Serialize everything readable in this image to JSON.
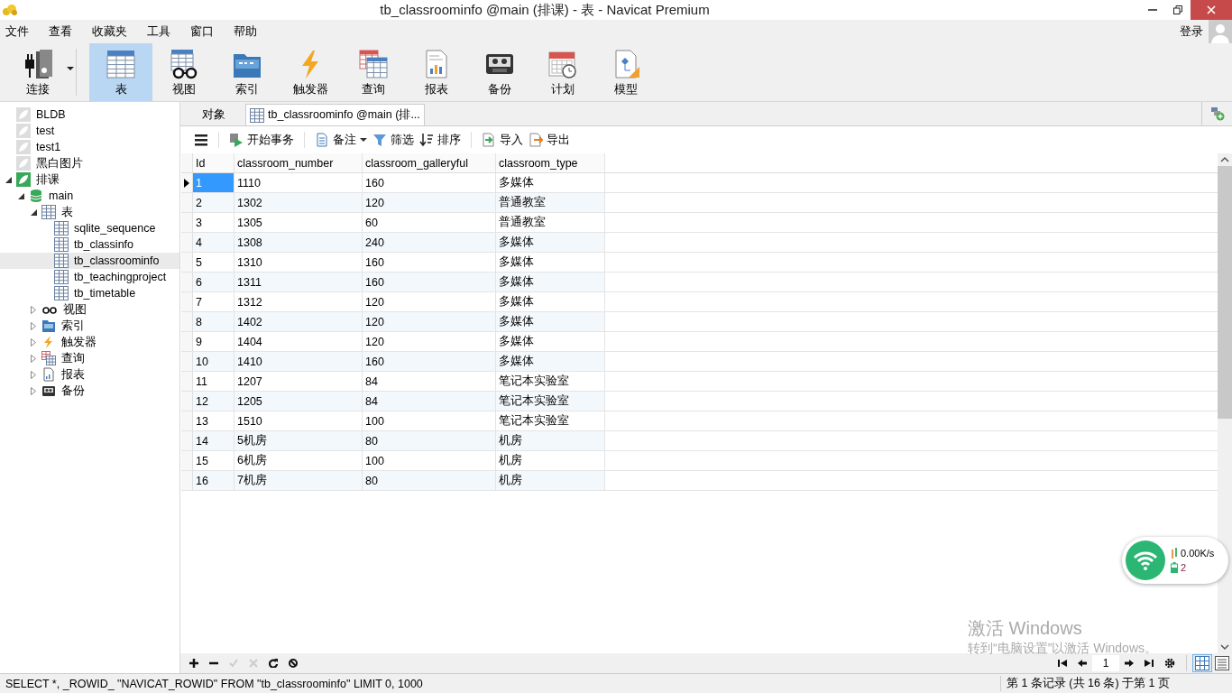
{
  "window": {
    "title": "tb_classroominfo @main (排课) - 表 - Navicat Premium"
  },
  "menu": [
    "文件",
    "查看",
    "收藏夹",
    "工具",
    "窗口",
    "帮助"
  ],
  "login": "登录",
  "toolbar": [
    {
      "kind": "connect",
      "label": "连接",
      "selected": false
    },
    {
      "kind": "table",
      "label": "表",
      "selected": true
    },
    {
      "kind": "view",
      "label": "视图",
      "selected": false
    },
    {
      "kind": "index",
      "label": "索引",
      "selected": false
    },
    {
      "kind": "trigger",
      "label": "触发器",
      "selected": false
    },
    {
      "kind": "query",
      "label": "查询",
      "selected": false
    },
    {
      "kind": "report",
      "label": "报表",
      "selected": false
    },
    {
      "kind": "backup",
      "label": "备份",
      "selected": false
    },
    {
      "kind": "schedule",
      "label": "计划",
      "selected": false
    },
    {
      "kind": "model",
      "label": "模型",
      "selected": false
    }
  ],
  "tree": [
    {
      "kind": "conn-off",
      "label": "BLDB",
      "selected": false
    },
    {
      "kind": "conn-off",
      "label": "test",
      "selected": false
    },
    {
      "kind": "conn-off",
      "label": "test1",
      "selected": false
    },
    {
      "kind": "conn-off",
      "label": "黑白图片",
      "selected": false
    },
    {
      "kind": "conn-on",
      "label": "排课",
      "selected": false,
      "expanded": true,
      "children": [
        {
          "kind": "db",
          "label": "main",
          "selected": false,
          "expanded": true,
          "children": [
            {
              "kind": "table",
              "label": "表",
              "selected": false,
              "expanded": true,
              "children": [
                {
                  "kind": "table",
                  "label": "sqlite_sequence",
                  "selected": false
                },
                {
                  "kind": "table",
                  "label": "tb_classinfo",
                  "selected": false
                },
                {
                  "kind": "table",
                  "label": "tb_classroominfo",
                  "selected": true
                },
                {
                  "kind": "table",
                  "label": "tb_teachingproject",
                  "selected": false
                },
                {
                  "kind": "table",
                  "label": "tb_timetable",
                  "selected": false
                }
              ]
            },
            {
              "kind": "view",
              "label": "视图",
              "selected": false,
              "expanded": false
            },
            {
              "kind": "index",
              "label": "索引",
              "selected": false,
              "expanded": false
            },
            {
              "kind": "trigger",
              "label": "触发器",
              "selected": false,
              "expanded": false
            },
            {
              "kind": "query",
              "label": "查询",
              "selected": false,
              "expanded": false
            },
            {
              "kind": "report",
              "label": "报表",
              "selected": false,
              "expanded": false
            },
            {
              "kind": "backup",
              "label": "备份",
              "selected": false,
              "expanded": false
            }
          ]
        }
      ]
    }
  ],
  "tabs": [
    {
      "label": "对象",
      "selected": false,
      "kind": "plain"
    },
    {
      "label": "tb_classroominfo @main (排...",
      "selected": true,
      "kind": "table"
    }
  ],
  "grid_toolbar": [
    {
      "kind": "menu"
    },
    {
      "kind": "begin",
      "label": "开始事务"
    },
    {
      "kind": "note",
      "label": "备注"
    },
    {
      "kind": "filter",
      "label": "筛选"
    },
    {
      "kind": "sort",
      "label": "排序"
    },
    {
      "kind": "import",
      "label": "导入"
    },
    {
      "kind": "export",
      "label": "导出"
    }
  ],
  "table": {
    "columns": [
      "Id",
      "classroom_number",
      "classroom_galleryful",
      "classroom_type"
    ],
    "rows": [
      {
        "selected": true,
        "cells": [
          "1",
          "1110",
          "160",
          "多媒体"
        ]
      },
      {
        "selected": false,
        "cells": [
          "2",
          "1302",
          "120",
          "普通教室"
        ]
      },
      {
        "selected": false,
        "cells": [
          "3",
          "1305",
          "60",
          "普通教室"
        ]
      },
      {
        "selected": false,
        "cells": [
          "4",
          "1308",
          "240",
          "多媒体"
        ]
      },
      {
        "selected": false,
        "cells": [
          "5",
          "1310",
          "160",
          "多媒体"
        ]
      },
      {
        "selected": false,
        "cells": [
          "6",
          "1311",
          "160",
          "多媒体"
        ]
      },
      {
        "selected": false,
        "cells": [
          "7",
          "1312",
          "120",
          "多媒体"
        ]
      },
      {
        "selected": false,
        "cells": [
          "8",
          "1402",
          "120",
          "多媒体"
        ]
      },
      {
        "selected": false,
        "cells": [
          "9",
          "1404",
          "120",
          "多媒体"
        ]
      },
      {
        "selected": false,
        "cells": [
          "10",
          "1410",
          "160",
          "多媒体"
        ]
      },
      {
        "selected": false,
        "cells": [
          "11",
          "1207",
          "84",
          "笔记本实验室"
        ]
      },
      {
        "selected": false,
        "cells": [
          "12",
          "1205",
          "84",
          "笔记本实验室"
        ]
      },
      {
        "selected": false,
        "cells": [
          "13",
          "1510",
          "100",
          "笔记本实验室"
        ]
      },
      {
        "selected": false,
        "cells": [
          "14",
          "5机房",
          "80",
          "机房"
        ]
      },
      {
        "selected": false,
        "cells": [
          "15",
          "6机房",
          "100",
          "机房"
        ]
      },
      {
        "selected": false,
        "cells": [
          "16",
          "7机房",
          "80",
          "机房"
        ]
      }
    ]
  },
  "edit_tools": [
    {
      "kind": "add",
      "disabled": false
    },
    {
      "kind": "delete",
      "disabled": false
    },
    {
      "kind": "apply",
      "disabled": true
    },
    {
      "kind": "discard",
      "disabled": true
    },
    {
      "kind": "refresh",
      "disabled": false
    },
    {
      "kind": "stop",
      "disabled": false
    }
  ],
  "pager": {
    "page": "1"
  },
  "view_modes": [
    {
      "kind": "grid",
      "selected": true
    },
    {
      "kind": "form",
      "selected": false
    }
  ],
  "status_bar": {
    "sql": "SELECT *, _ROWID_ \"NAVICAT_ROWID\" FROM \"tb_classroominfo\" LIMIT 0, 1000",
    "records": "第 1 条记录 (共 16 条) 于第 1 页"
  },
  "network_widget": {
    "speed": "0.00K/s",
    "count": "2"
  },
  "activation": {
    "title": "激活 Windows",
    "hint": "转到“电脑设置”以激活 Windows。"
  }
}
